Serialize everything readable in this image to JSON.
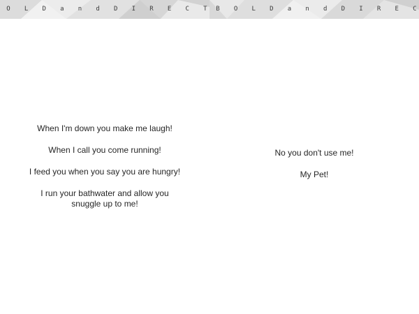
{
  "banner": {
    "left_letters": [
      "O",
      "L",
      "D",
      "a",
      "n",
      "d",
      "D",
      "I",
      "R",
      "E",
      "C",
      "T"
    ],
    "right_letters": [
      "B",
      "O",
      "L",
      "D",
      "a",
      "n",
      "d",
      "D",
      "I",
      "R",
      "E",
      "C"
    ]
  },
  "left_page": {
    "stanzas": [
      "When I'm down you make me laugh!",
      "When I call you come running!",
      "I feed you when you say you are hungry!",
      "I run your bathwater and allow you snuggle up to me!"
    ]
  },
  "right_page": {
    "stanzas": [
      "No you don't use me!",
      "My Pet!"
    ]
  }
}
